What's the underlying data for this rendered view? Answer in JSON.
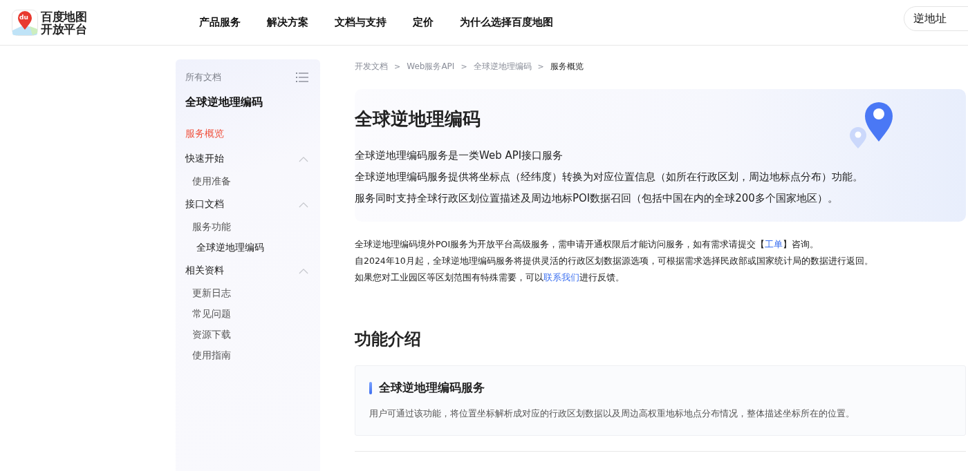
{
  "header": {
    "logo_text": [
      "百度地图",
      "开放平台"
    ],
    "logo_badge": "du",
    "nav": [
      "产品服务",
      "解决方案",
      "文档与支持",
      "定价",
      "为什么选择百度地图"
    ],
    "search": {
      "value": "逆地址"
    }
  },
  "sidebar": {
    "heading": "所有文档",
    "title": "全球逆地理编码",
    "items": [
      {
        "label": "服务概览",
        "selected": true
      },
      {
        "label": "快速开始",
        "selected": false,
        "expanded": true,
        "children": [
          {
            "label": "使用准备",
            "selected": false
          }
        ]
      },
      {
        "label": "接口文档",
        "selected": false,
        "expanded": true,
        "children": [
          {
            "label": "服务功能",
            "selected": false,
            "children": [
              {
                "label": "全球逆地理编码",
                "selected": false
              }
            ]
          }
        ]
      },
      {
        "label": "相关资料",
        "selected": false,
        "expanded": true,
        "children": [
          {
            "label": "更新日志",
            "selected": false
          },
          {
            "label": "常见问题",
            "selected": false
          },
          {
            "label": "资源下载",
            "selected": false
          },
          {
            "label": "使用指南",
            "selected": false
          }
        ]
      }
    ]
  },
  "breadcrumb": {
    "separator": ">",
    "items": [
      "开发文档",
      "Web服务API",
      "全球逆地理编码",
      "服务概览"
    ]
  },
  "hero": {
    "title": "全球逆地理编码",
    "intro": [
      "全球逆地理编码服务是一类Web API接口服务",
      "全球逆地理编码服务提供将坐标点（经纬度）转换为对应位置信息（如所在行政区划，周边地标点分布）功能。",
      "服务同时支持全球行政区划位置描述及周边地标POI数据召回（包括中国在内的全球200多个国家地区）。"
    ]
  },
  "notices": [
    [
      {
        "kind": "text",
        "text": "全球逆地理编码境外POI服务为开放平台高级服务，需申请开通权限后才能访问服务，如有需求请提交【"
      },
      {
        "kind": "link",
        "text": "工单"
      },
      {
        "kind": "text",
        "text": "】咨询。"
      }
    ],
    [
      {
        "kind": "text",
        "text": "自2024年10月起，全球逆地理编码服务将提供灵活的行政区划数据源选项，可根据需求选择民政部或国家统计局的数据进行返回。"
      }
    ],
    [
      {
        "kind": "text",
        "text": "如果您对工业园区等区划范围有特殊需要，可以"
      },
      {
        "kind": "link",
        "text": "联系我们"
      },
      {
        "kind": "text",
        "text": "进行反馈。"
      }
    ]
  ],
  "section": {
    "title": "功能介绍",
    "cards": [
      {
        "title": "全球逆地理编码服务",
        "description": "用户可通过该功能，将位置坐标解析成对应的行政区划数据以及周边高权重地标地点分布情况，整体描述坐标所在的位置。"
      }
    ]
  }
}
